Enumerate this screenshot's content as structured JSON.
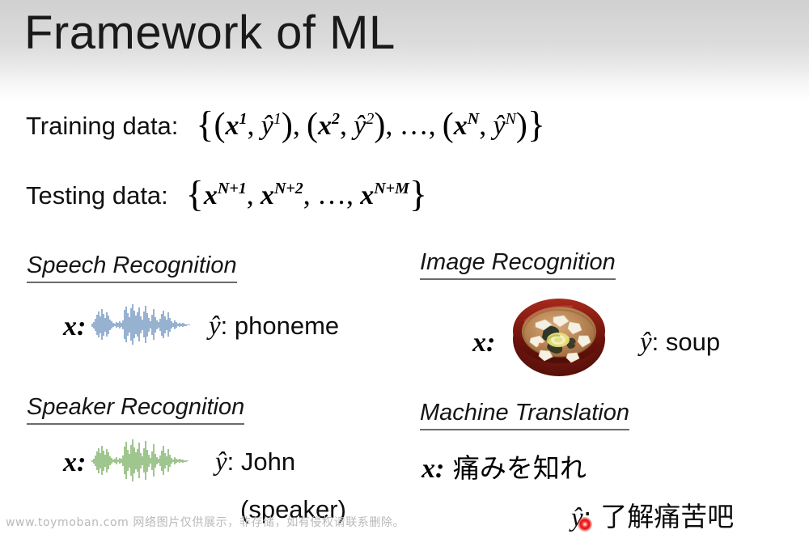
{
  "slide": {
    "title": "Framework of ML",
    "background_top_color": "#d0d0d0",
    "background_bottom_color": "#ffffff"
  },
  "data_lines": {
    "training": {
      "label": "Training data:",
      "formula_text": "{(x1, ŷ1), (x2, ŷ2), …, (xN, ŷN)}",
      "open_brace": "{",
      "open_paren": "(",
      "x_symbol": "x",
      "y_symbol": "ŷ",
      "pair1_x_sup": "1",
      "pair1_y_sup": "1",
      "pair2_x_sup": "2",
      "pair2_y_sup": "2",
      "pairN_x_sup": "N",
      "pairN_y_sup": "N",
      "comma": ",",
      "ellipsis": "…",
      "close_paren": ")",
      "close_brace": "}"
    },
    "testing": {
      "label": "Testing data:",
      "formula_text": "{xN+1, xN+2, …, xN+M}",
      "open_brace": "{",
      "x_symbol": "x",
      "sup1": "N+1",
      "sup2": "N+2",
      "sup3": "N+M",
      "comma": ",",
      "ellipsis": "…",
      "close_brace": "}"
    }
  },
  "sections": [
    {
      "id": "speech-recognition",
      "heading": "Speech Recognition",
      "input_label": "x:",
      "input_kind": "waveform",
      "waveform_color": "#2f64a3",
      "output_label": "ŷ: phoneme",
      "output_y_symbol": "ŷ",
      "output_value": ": phoneme"
    },
    {
      "id": "speaker-recognition",
      "heading": "Speaker Recognition",
      "input_label": "x:",
      "input_kind": "waveform",
      "waveform_color": "#3f8c1e",
      "output_label": "ŷ: John",
      "output_y_symbol": "ŷ",
      "output_value": ": John",
      "output_value_line2": "(speaker)"
    },
    {
      "id": "image-recognition",
      "heading": "Image Recognition",
      "input_label": "x:",
      "input_kind": "photo-miso-soup",
      "output_label": "ŷ: soup",
      "output_y_symbol": "ŷ",
      "output_value": ": soup"
    },
    {
      "id": "machine-translation",
      "heading": "Machine Translation",
      "input_label": "x:",
      "input_kind": "text",
      "input_value": " 痛みを知れ",
      "output_label": "ŷ: 了解痛苦吧",
      "output_y_symbol": "ŷ",
      "output_value": ": 了解痛苦吧"
    }
  ],
  "laser_pointer": {
    "color": "#e01010",
    "visible": true
  },
  "watermark": {
    "text": "www.toymoban.com 网络图片仅供展示，非存储，如有侵权请联系删除。"
  }
}
